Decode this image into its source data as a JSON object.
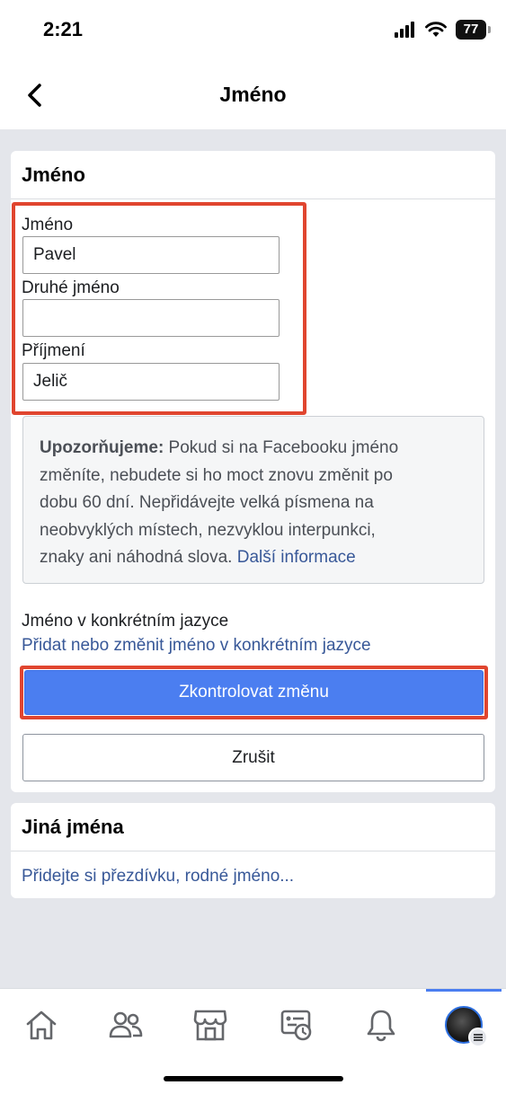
{
  "status_bar": {
    "time": "2:21",
    "battery": "77"
  },
  "nav": {
    "title": "Jméno"
  },
  "name_card": {
    "header": "Jméno",
    "first_name_label": "Jméno",
    "first_name_value": "Pavel",
    "middle_name_label": "Druhé jméno",
    "middle_name_value": "",
    "last_name_label": "Příjmení",
    "last_name_value": "Jelič",
    "notice_bold": "Upozorňujeme:",
    "notice_line1": " Pokud si na Facebooku jméno",
    "notice_line2": "změníte, nebudete si ho moct znovu změnit po",
    "notice_line3": "dobu 60 dní. Nepřidávejte velká písmena na",
    "notice_line4": "neobvyklých místech, nezvyklou interpunkci,",
    "notice_line5": "znaky ani náhodná slova. ",
    "notice_link": "Další informace",
    "language_title": "Jméno v konkrétním jazyce",
    "language_link": "Přidat nebo změnit jméno v konkrétním jazyce",
    "review_button": "Zkontrolovat změnu",
    "cancel_button": "Zrušit"
  },
  "other_names_card": {
    "header": "Jiná jména",
    "add_link": "Přidejte si přezdívku, rodné jméno..."
  },
  "colors": {
    "accent": "#4b7ef0",
    "link": "#385898",
    "highlight": "#e0452f"
  },
  "tab_bar": {
    "tabs": [
      "home-icon",
      "friends-icon",
      "marketplace-icon",
      "memories-icon",
      "notifications-icon",
      "profile-menu"
    ],
    "active": "profile-menu"
  }
}
